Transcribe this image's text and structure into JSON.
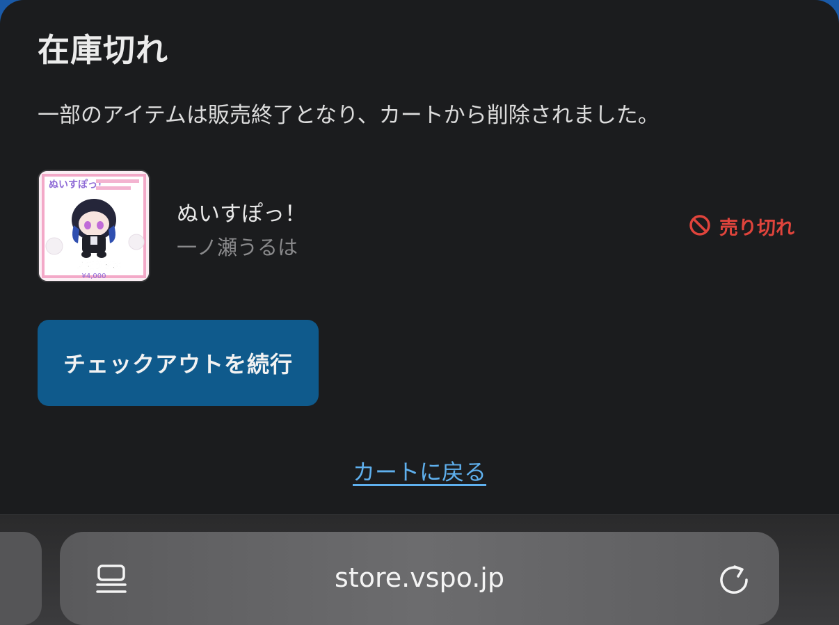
{
  "dialog": {
    "title": "在庫切れ",
    "message": "一部のアイテムは販売終了となり、カートから削除されました。"
  },
  "item": {
    "name": "ぬいすぽっ！",
    "variant": "一ノ瀬うるは",
    "status_label": "売り切れ",
    "status_icon": "prohibited-icon",
    "status_color": "#e0443c",
    "thumbnail": {
      "logo_text": "ぬいすぽっ！",
      "caption": "一ノ瀬うるは",
      "price": "¥4,000"
    }
  },
  "actions": {
    "checkout_label": "チェックアウトを続行",
    "checkout_color": "#0f5a8c",
    "back_label": "カートに戻る",
    "back_color": "#5fb0ee"
  },
  "browser": {
    "url": "store.vspo.jp",
    "left_icon": "tabs-icon",
    "right_icon": "reload-icon"
  }
}
